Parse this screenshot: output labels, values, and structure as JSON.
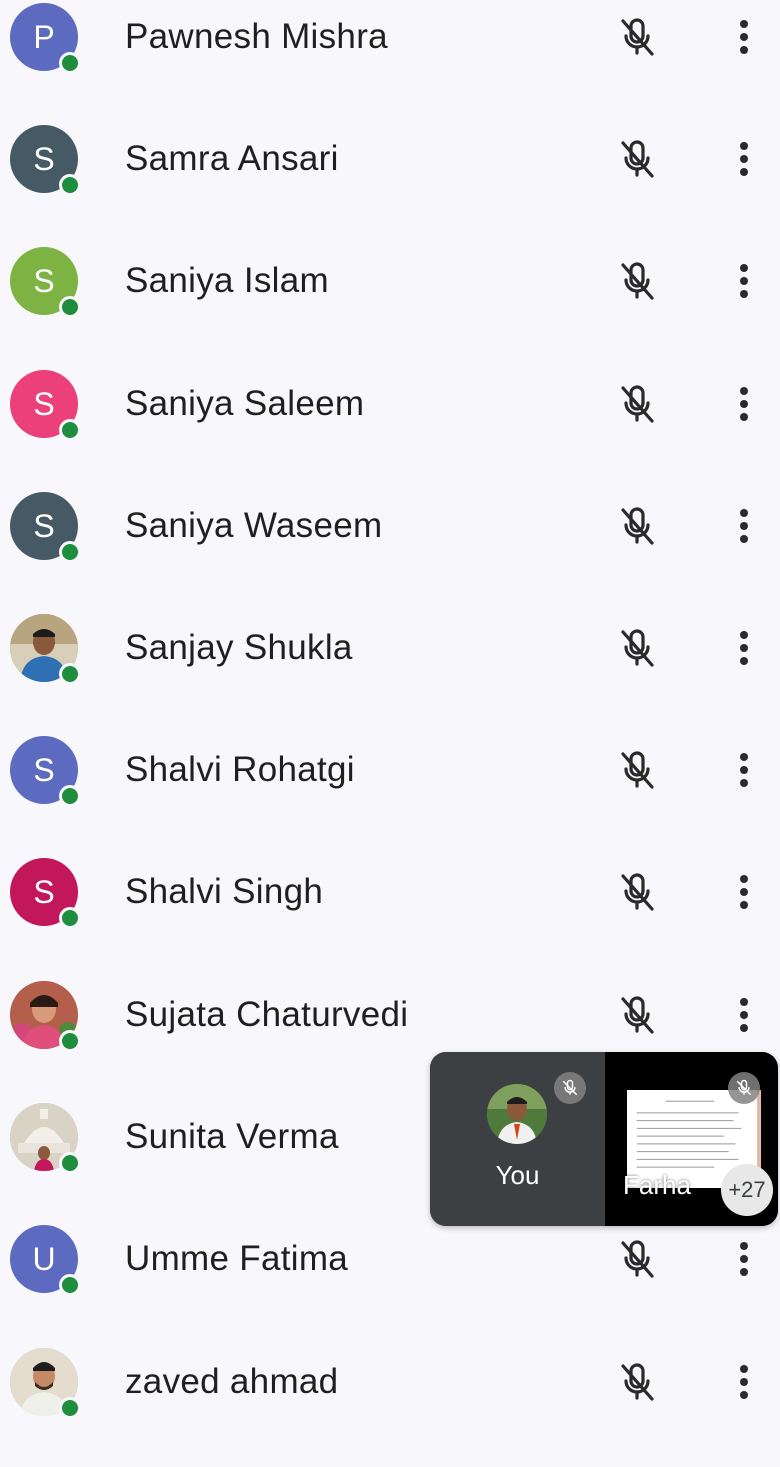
{
  "participants": [
    {
      "name": "Pawnesh Mishra",
      "initial": "P",
      "color": "#5c6bc0"
    },
    {
      "name": "Samra Ansari",
      "initial": "S",
      "color": "#455a64"
    },
    {
      "name": "Saniya Islam",
      "initial": "S",
      "color": "#7cb342"
    },
    {
      "name": "Saniya Saleem",
      "initial": "S",
      "color": "#ec407a"
    },
    {
      "name": "Saniya Waseem",
      "initial": "S",
      "color": "#455a64"
    },
    {
      "name": "Sanjay Shukla",
      "initial": "",
      "color": "#c9b59a",
      "photo": true
    },
    {
      "name": "Shalvi Rohatgi",
      "initial": "S",
      "color": "#5c6bc0"
    },
    {
      "name": "Shalvi Singh",
      "initial": "S",
      "color": "#c2185b"
    },
    {
      "name": "Sujata Chaturvedi",
      "initial": "",
      "color": "#b86b5a",
      "photo": true
    },
    {
      "name": "Sunita Verma",
      "initial": "",
      "color": "#d9d3c6",
      "photo": true
    },
    {
      "name": "Umme Fatima",
      "initial": "U",
      "color": "#5c6bc0"
    },
    {
      "name": "zaved ahmad",
      "initial": "",
      "color": "#e4dccd",
      "photo": true
    }
  ],
  "preview": {
    "self_label": "You",
    "presenter_label": "Farha",
    "more_count": "+27"
  },
  "colors": {
    "online": "#1e8e3e",
    "panel_bg": "#3c4043",
    "icon": "#2a2a2a"
  },
  "icons": {
    "mic": "mic-off-icon",
    "menu": "more-vert-icon",
    "status": "online-status-icon"
  }
}
